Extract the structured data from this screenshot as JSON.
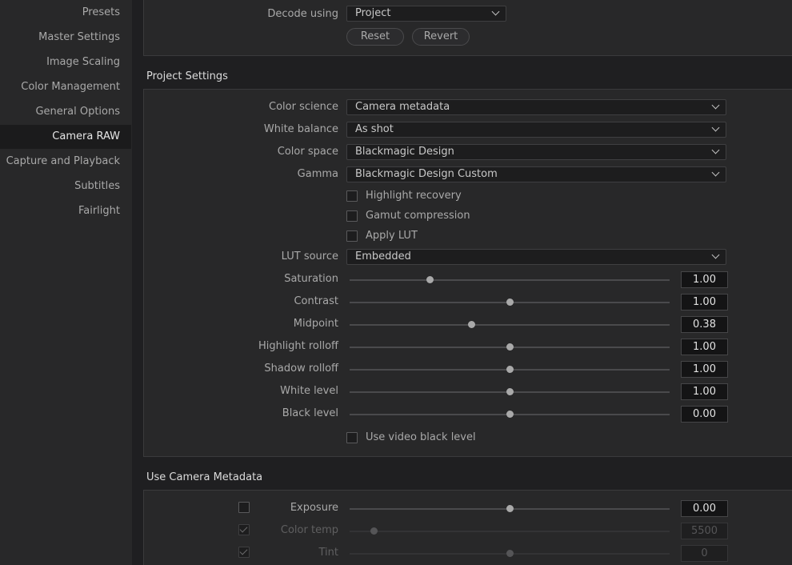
{
  "sidebar": {
    "items": [
      {
        "label": "Presets",
        "active": false
      },
      {
        "label": "Master Settings",
        "active": false
      },
      {
        "label": "Image Scaling",
        "active": false
      },
      {
        "label": "Color Management",
        "active": false
      },
      {
        "label": "General Options",
        "active": false
      },
      {
        "label": "Camera RAW",
        "active": true
      },
      {
        "label": "Capture and Playback",
        "active": false
      },
      {
        "label": "Subtitles",
        "active": false
      },
      {
        "label": "Fairlight",
        "active": false
      }
    ]
  },
  "decode": {
    "label": "Decode using",
    "value": "Project",
    "reset_label": "Reset",
    "revert_label": "Revert"
  },
  "project_settings": {
    "title": "Project Settings",
    "dropdowns": [
      {
        "label": "Color science",
        "value": "Camera metadata"
      },
      {
        "label": "White balance",
        "value": "As shot"
      },
      {
        "label": "Color space",
        "value": "Blackmagic Design"
      },
      {
        "label": "Gamma",
        "value": "Blackmagic Design Custom"
      }
    ],
    "checkboxes": [
      {
        "label": "Highlight recovery",
        "checked": false
      },
      {
        "label": "Gamut compression",
        "checked": false
      },
      {
        "label": "Apply LUT",
        "checked": false
      }
    ],
    "lut_source": {
      "label": "LUT source",
      "value": "Embedded"
    },
    "sliders": [
      {
        "label": "Saturation",
        "value": "1.00",
        "position": 0.25
      },
      {
        "label": "Contrast",
        "value": "1.00",
        "position": 0.5
      },
      {
        "label": "Midpoint",
        "value": "0.38",
        "position": 0.38
      },
      {
        "label": "Highlight rolloff",
        "value": "1.00",
        "position": 0.5
      },
      {
        "label": "Shadow rolloff",
        "value": "1.00",
        "position": 0.5
      },
      {
        "label": "White level",
        "value": "1.00",
        "position": 0.5
      },
      {
        "label": "Black level",
        "value": "0.00",
        "position": 0.5
      }
    ],
    "video_black": {
      "label": "Use video black level",
      "checked": false
    }
  },
  "camera_metadata": {
    "title": "Use Camera Metadata",
    "rows": [
      {
        "label": "Exposure",
        "value": "0.00",
        "checked": false,
        "enabled": true,
        "position": 0.5
      },
      {
        "label": "Color temp",
        "value": "5500",
        "checked": true,
        "enabled": false,
        "position": 0.075
      },
      {
        "label": "Tint",
        "value": "0",
        "checked": true,
        "enabled": false,
        "position": 0.5
      }
    ]
  },
  "colors": {
    "background": "#1f1f21",
    "panel": "#282829",
    "sidebar_active": "#1b1b1c",
    "text": "#a9a9a9"
  }
}
